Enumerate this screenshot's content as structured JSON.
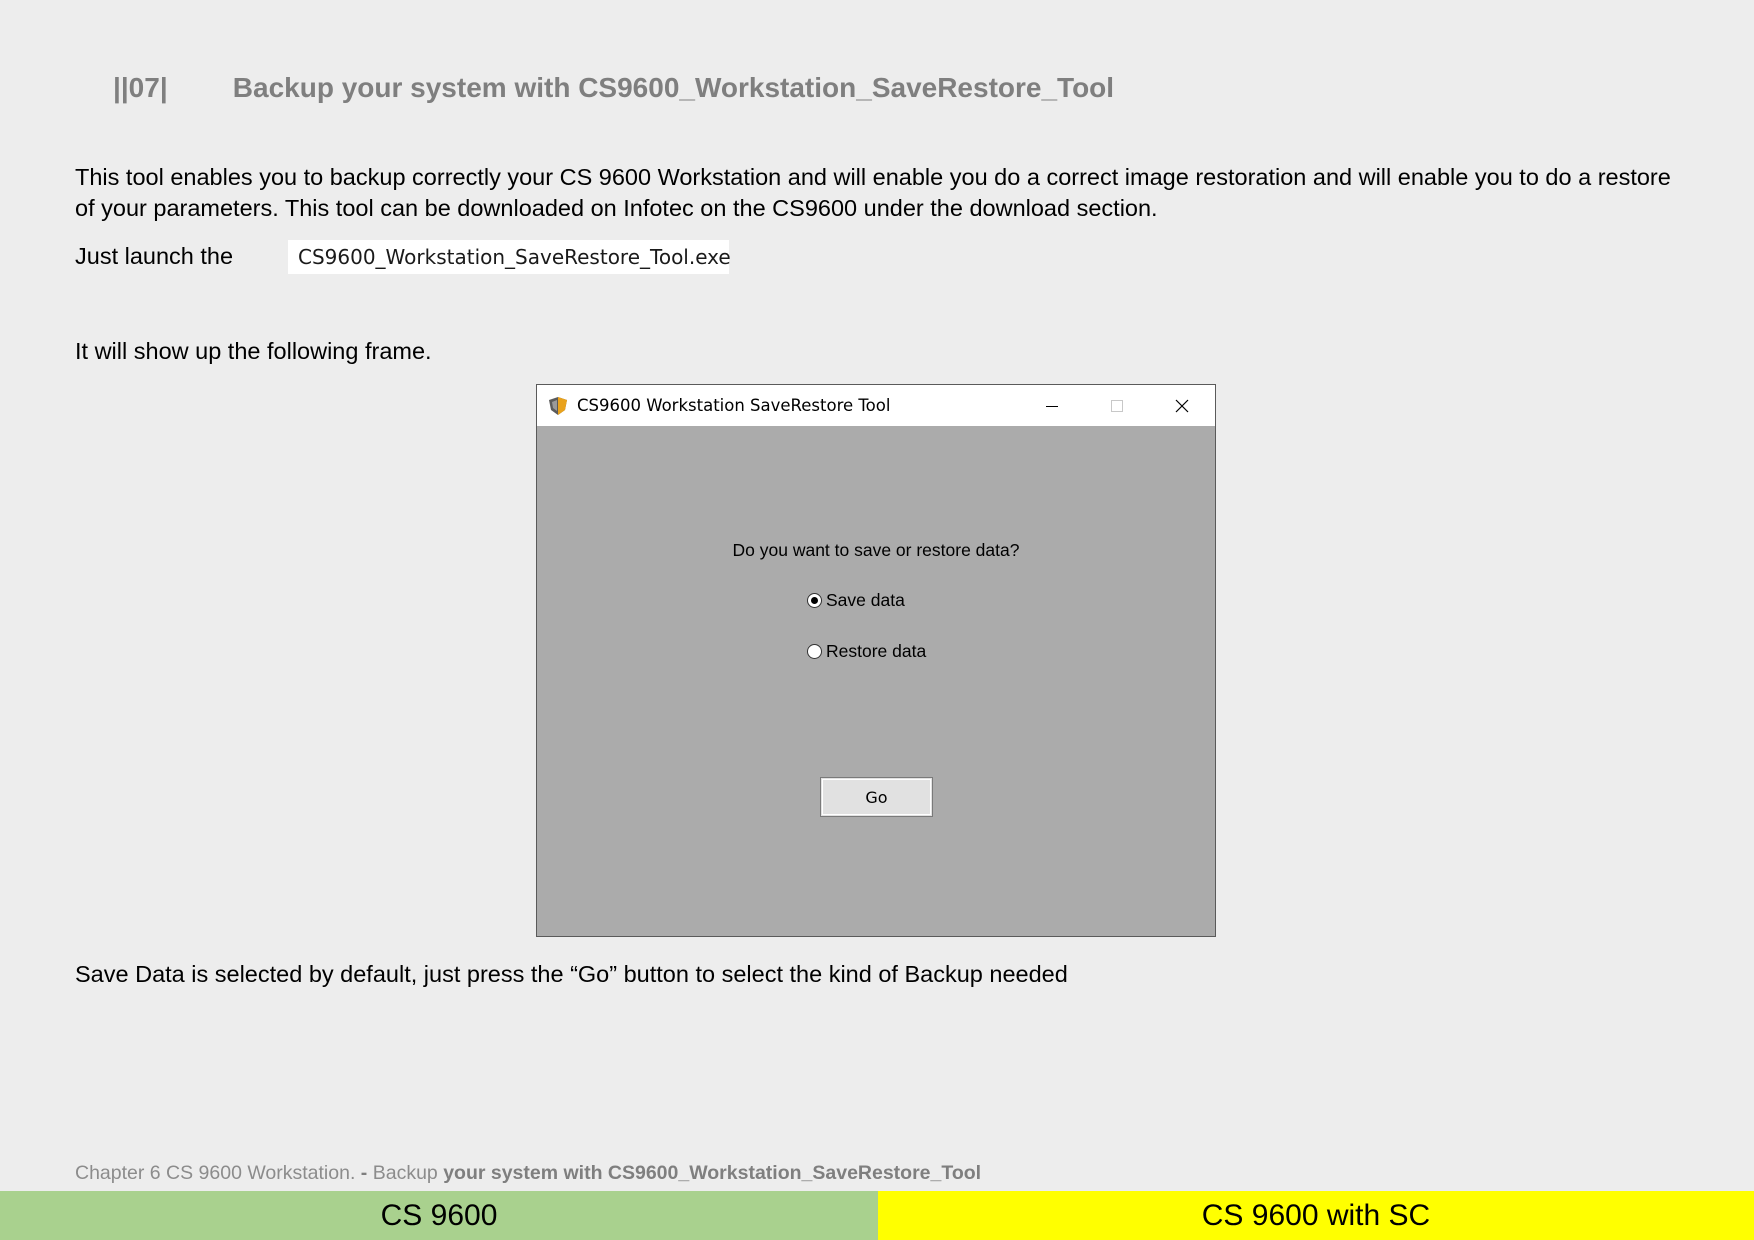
{
  "heading": {
    "number": "||07|",
    "title": "Backup your system with CS9600_Workstation_SaveRestore_Tool"
  },
  "paragraphs": {
    "intro": "This tool enables you to backup correctly your CS 9600 Workstation and will enable you do a correct image restoration and will enable you to do a restore of your parameters. This tool can be downloaded on Infotec on the CS9600 under the download section.",
    "launch_prefix": "Just launch the",
    "show_frame": "It will show up the following frame.",
    "default_note": "Save Data is selected by default, just press the “Go” button to select the kind of Backup needed"
  },
  "exe_file": {
    "icon": "app-shield-icon",
    "name": "CS9600_Workstation_SaveRestore_Tool.exe"
  },
  "dialog": {
    "title": "CS9600 Workstation SaveRestore Tool",
    "question": "Do you want to save or restore data?",
    "options": [
      {
        "label": "Save data",
        "selected": true
      },
      {
        "label": "Restore data",
        "selected": false
      }
    ],
    "go_label": "Go",
    "background": "#ababab"
  },
  "footer": {
    "chapter_prefix": "Chapter 6 CS 9600 Workstation. ",
    "dash": "- ",
    "backup_word": "Backup ",
    "chapter_title_rest": "your system with CS9600_Workstation_SaveRestore_Tool"
  },
  "tabs": {
    "left": {
      "label": "CS 9600",
      "color": "#a9d18e"
    },
    "right": {
      "label": "CS 9600 with SC",
      "color": "#ffff00"
    }
  }
}
